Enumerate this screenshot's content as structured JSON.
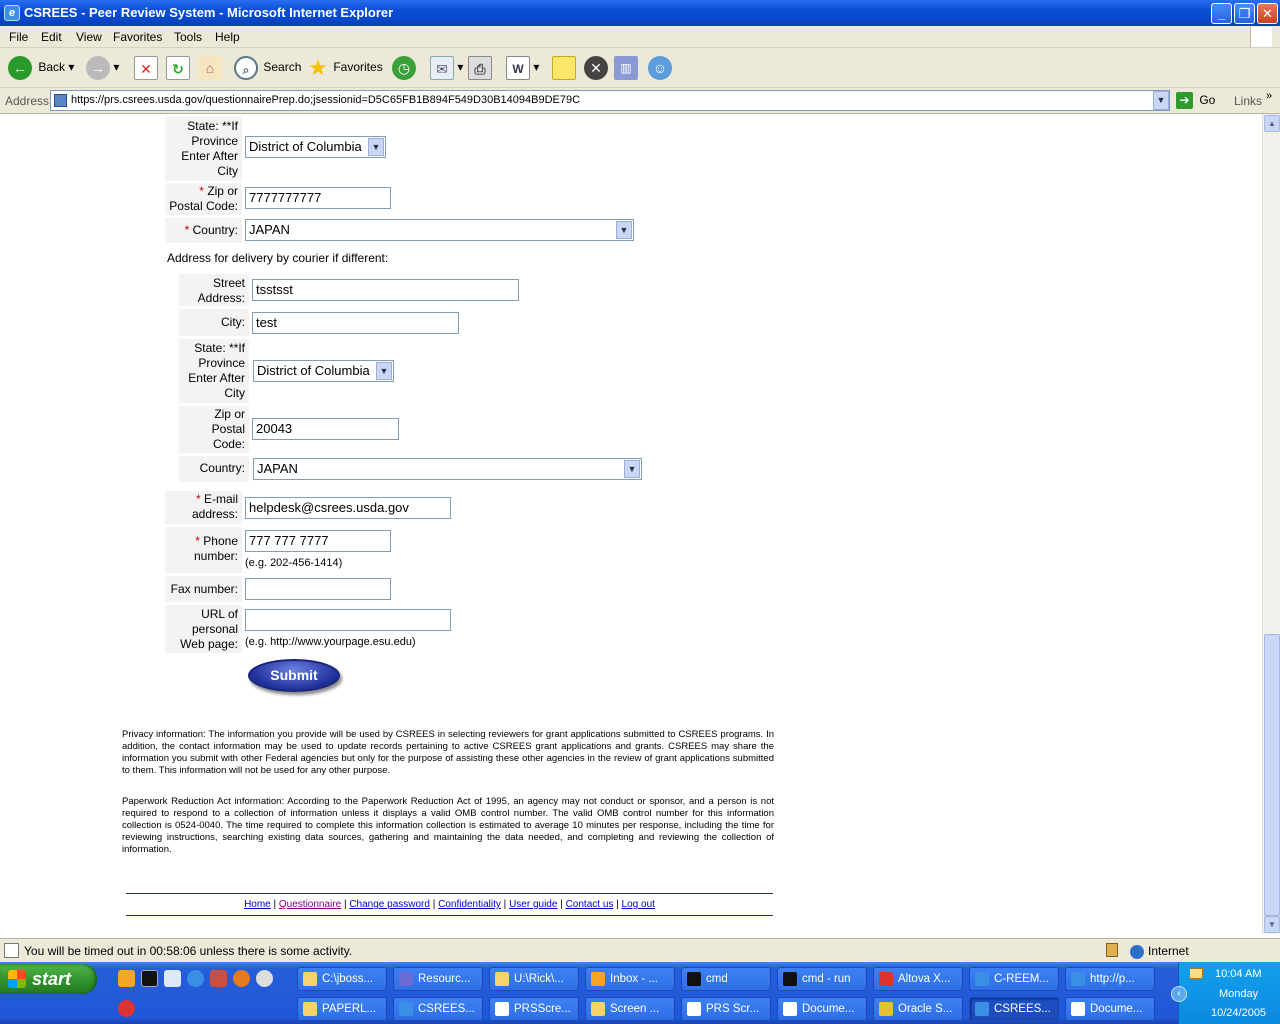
{
  "window": {
    "title": "CSREES - Peer Review System - Microsoft Internet Explorer"
  },
  "menu": [
    "File",
    "Edit",
    "View",
    "Favorites",
    "Tools",
    "Help"
  ],
  "toolbar": {
    "back": "Back",
    "search": "Search",
    "favorites": "Favorites"
  },
  "address": {
    "label": "Address",
    "url": "https://prs.csrees.usda.gov/questionnairePrep.do;jsessionid=D5C65FB1B894F549D30B14094B9DE79C",
    "go": "Go",
    "links": "Links"
  },
  "form": {
    "state_label": "State: **If Province Enter After City",
    "state_value": "District of Columbia",
    "zip_label": "Zip or Postal Code:",
    "zip_value": "7777777777",
    "country_label": "Country:",
    "country_value": "JAPAN",
    "courier_heading": "Address for delivery by courier if different:",
    "courier": {
      "street_label": "Street Address:",
      "street_value": "tsstsst",
      "city_label": "City:",
      "city_value": "test",
      "state_label": "State: **If Province Enter After City",
      "state_value": "District of Columbia",
      "zip_label": "Zip or Postal Code:",
      "zip_value": "20043",
      "country_label": "Country:",
      "country_value": "JAPAN"
    },
    "email_label": "E-mail address:",
    "email_value": "helpdesk@csrees.usda.gov",
    "phone_label": "Phone number:",
    "phone_value": "777 777 7777",
    "phone_hint": "(e.g. 202-456-1414)",
    "fax_label": "Fax number:",
    "fax_value": "",
    "url_label": "URL of personal Web page:",
    "url_value": "",
    "url_hint": "(e.g. http://www.yourpage.esu.edu)",
    "submit": "Submit"
  },
  "privacy_text": "Privacy information: The information you provide will be used by CSREES in selecting reviewers for grant applications submitted to CSREES programs. In addition, the contact information may be used to update records pertaining to active CSREES grant applications and grants. CSREES may share the information you submit with other Federal agencies but only for the purpose of assisting these other agencies in the review of grant applications submitted to them. This information will not be used for any other purpose.",
  "paperwork_text": "Paperwork Reduction Act information: According to the Paperwork Reduction Act of 1995, an agency may not conduct or sponsor, and a person is not required to respond to a collection of information unless it displays a valid OMB control number. The valid OMB control number for this information collection is 0524-0040. The time required to complete this information collection is estimated to average 10 minutes per response, including the time for reviewing instructions, searching existing data sources, gathering and maintaining the data needed, and completing and reviewing the collection of information.",
  "footer_links": [
    "Home",
    "Questionnaire",
    "Change password",
    "Confidentiality",
    "User guide",
    "Contact us",
    "Log out"
  ],
  "status": {
    "text": "You will be timed out in 00:58:06 unless there is some activity.",
    "zone": "Internet"
  },
  "taskbar": {
    "start": "start",
    "tasks_row1": [
      "C:\\jboss...",
      "Resourc...",
      "U:\\Rick\\...",
      "Inbox - ...",
      "cmd",
      "cmd - run",
      "Altova X...",
      "C-REEM...",
      "http://p..."
    ],
    "tasks_row2": [
      "PAPERL...",
      "CSREES...",
      "PRSScre...",
      "Screen ...",
      "PRS Scr...",
      "Docume...",
      "Oracle S...",
      "CSREES...",
      "Docume..."
    ],
    "clock": {
      "time": "10:04 AM",
      "day": "Monday",
      "date": "10/24/2005"
    }
  }
}
